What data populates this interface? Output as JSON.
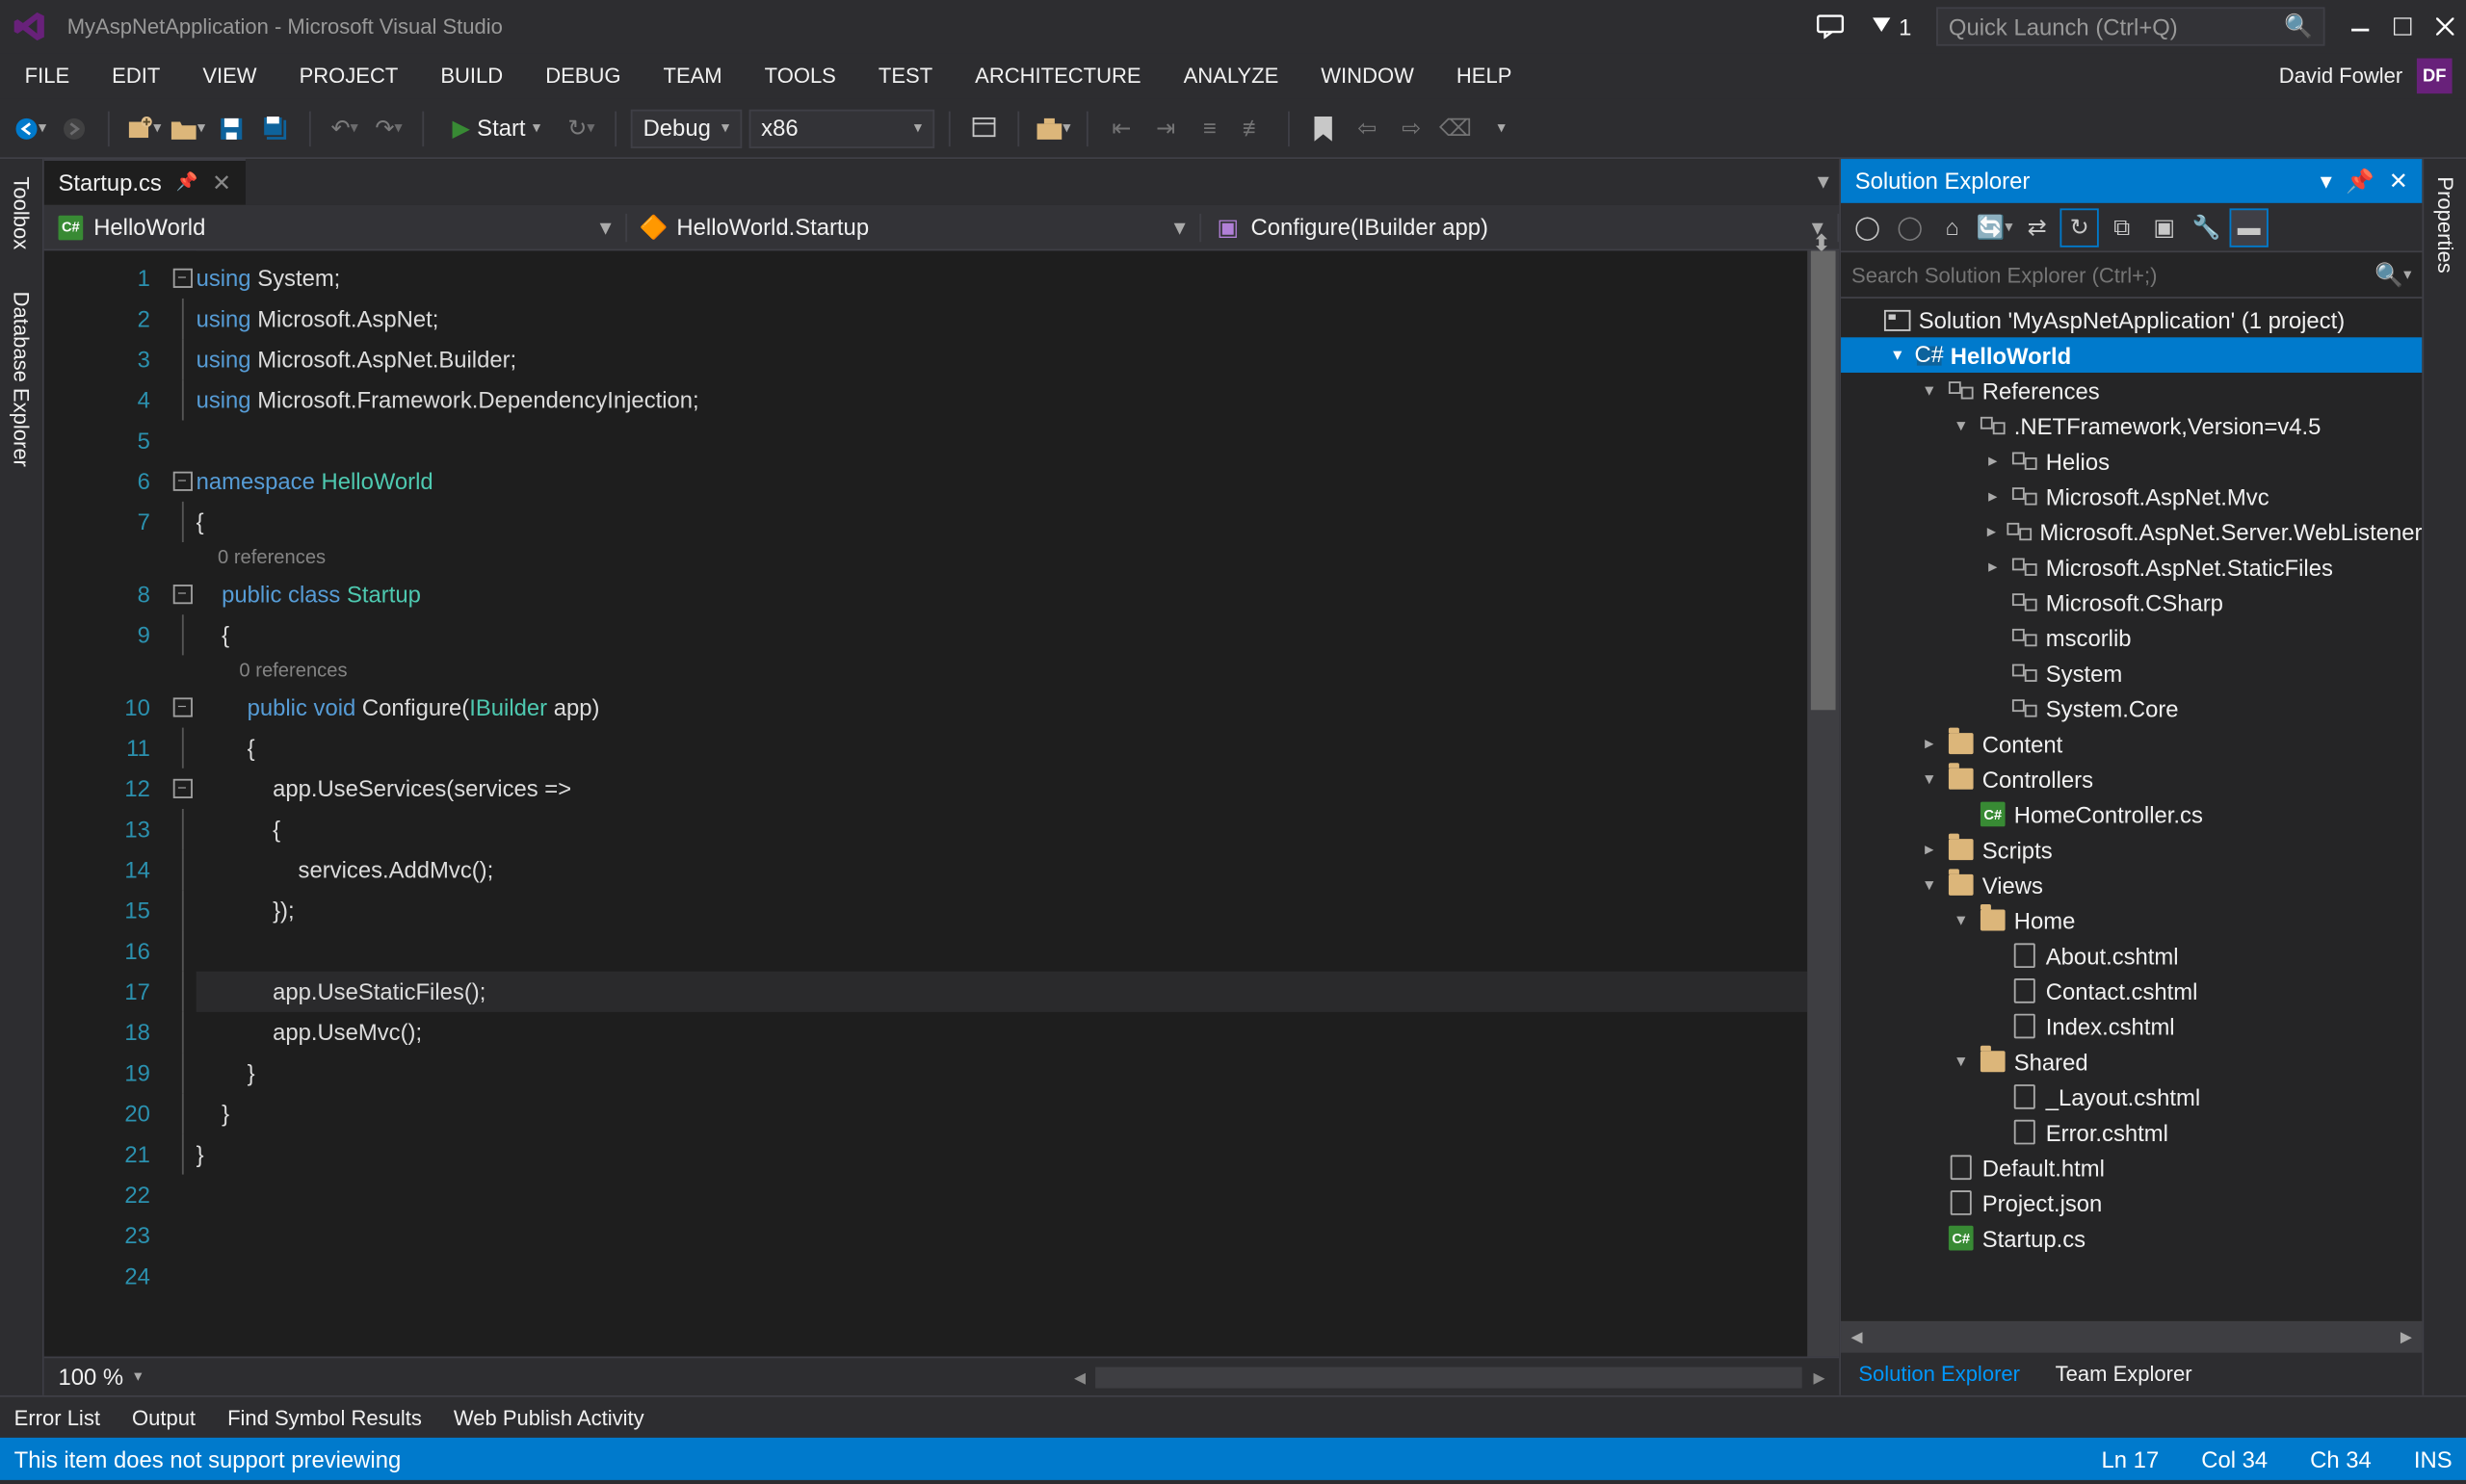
{
  "title": "MyAspNetApplication - Microsoft Visual Studio",
  "notifications_count": "1",
  "quick_launch_placeholder": "Quick Launch (Ctrl+Q)",
  "menu": [
    "FILE",
    "EDIT",
    "VIEW",
    "PROJECT",
    "BUILD",
    "DEBUG",
    "TEAM",
    "TOOLS",
    "TEST",
    "ARCHITECTURE",
    "ANALYZE",
    "WINDOW",
    "HELP"
  ],
  "user": {
    "name": "David Fowler",
    "initials": "DF"
  },
  "toolbar": {
    "start": "Start",
    "config": "Debug",
    "platform": "x86"
  },
  "left_tabs": [
    "Toolbox",
    "Database Explorer"
  ],
  "right_tabs": [
    "Properties"
  ],
  "editor": {
    "tab_name": "Startup.cs",
    "nav1": "HelloWorld",
    "nav2": "HelloWorld.Startup",
    "nav3": "Configure(IBuilder app)",
    "zoom": "100 %",
    "codelens": "0 references",
    "lines": [
      {
        "n": 1,
        "fold": "-",
        "html": "<span class='kw'>using</span> System;"
      },
      {
        "n": 2,
        "fold": "|",
        "html": "<span class='kw'>using</span> Microsoft.AspNet;"
      },
      {
        "n": 3,
        "fold": "|",
        "html": "<span class='kw'>using</span> Microsoft.AspNet.Builder;"
      },
      {
        "n": 4,
        "fold": "|",
        "html": "<span class='kw'>using</span> Microsoft.Framework.DependencyInjection;"
      },
      {
        "n": 5,
        "fold": "",
        "html": ""
      },
      {
        "n": 6,
        "fold": "-",
        "html": "<span class='kw'>namespace</span> <span class='type'>HelloWorld</span>"
      },
      {
        "n": 7,
        "fold": "|",
        "html": "{"
      },
      {
        "n": 0,
        "fold": "",
        "codelens": true,
        "indent": "    "
      },
      {
        "n": 8,
        "fold": "-",
        "html": "    <span class='kw'>public</span> <span class='kw'>class</span> <span class='type'>Startup</span>"
      },
      {
        "n": 9,
        "fold": "|",
        "html": "    {"
      },
      {
        "n": 0,
        "fold": "",
        "codelens": true,
        "indent": "        "
      },
      {
        "n": 10,
        "fold": "-",
        "html": "        <span class='kw'>public</span> <span class='kw'>void</span> Configure(<span class='type'>IBuilder</span> app)"
      },
      {
        "n": 11,
        "fold": "|",
        "html": "        {"
      },
      {
        "n": 12,
        "fold": "-",
        "html": "            app.UseServices(services =&gt;"
      },
      {
        "n": 13,
        "fold": "|",
        "html": "            {"
      },
      {
        "n": 14,
        "fold": "|",
        "html": "                services.AddMvc();"
      },
      {
        "n": 15,
        "fold": "|",
        "html": "            });"
      },
      {
        "n": 16,
        "fold": "|",
        "html": ""
      },
      {
        "n": 17,
        "fold": "|",
        "hl": true,
        "html": "            app.UseStaticFiles();"
      },
      {
        "n": 18,
        "fold": "|",
        "html": "            app.UseMvc();"
      },
      {
        "n": 19,
        "fold": "|",
        "html": "        }"
      },
      {
        "n": 20,
        "fold": "|",
        "html": "    }"
      },
      {
        "n": 21,
        "fold": "|",
        "html": "}"
      },
      {
        "n": 22,
        "fold": "",
        "html": ""
      },
      {
        "n": 23,
        "fold": "",
        "html": ""
      },
      {
        "n": 24,
        "fold": "",
        "html": ""
      }
    ]
  },
  "solution_explorer": {
    "title": "Solution Explorer",
    "search_placeholder": "Search Solution Explorer (Ctrl+;)",
    "tree": [
      {
        "d": 0,
        "exp": "",
        "icon": "sln",
        "label": "Solution 'MyAspNetApplication' (1 project)"
      },
      {
        "d": 1,
        "exp": "▾",
        "icon": "proj",
        "label": "HelloWorld",
        "sel": true,
        "bold": true
      },
      {
        "d": 2,
        "exp": "▾",
        "icon": "ref",
        "label": "References"
      },
      {
        "d": 3,
        "exp": "▾",
        "icon": "ref",
        "label": ".NETFramework,Version=v4.5"
      },
      {
        "d": 4,
        "exp": "▸",
        "icon": "ref",
        "label": "Helios"
      },
      {
        "d": 4,
        "exp": "▸",
        "icon": "ref",
        "label": "Microsoft.AspNet.Mvc"
      },
      {
        "d": 4,
        "exp": "▸",
        "icon": "ref",
        "label": "Microsoft.AspNet.Server.WebListener"
      },
      {
        "d": 4,
        "exp": "▸",
        "icon": "ref",
        "label": "Microsoft.AspNet.StaticFiles"
      },
      {
        "d": 4,
        "exp": "",
        "icon": "ref",
        "label": "Microsoft.CSharp"
      },
      {
        "d": 4,
        "exp": "",
        "icon": "ref",
        "label": "mscorlib"
      },
      {
        "d": 4,
        "exp": "",
        "icon": "ref",
        "label": "System"
      },
      {
        "d": 4,
        "exp": "",
        "icon": "ref",
        "label": "System.Core"
      },
      {
        "d": 2,
        "exp": "▸",
        "icon": "folder",
        "label": "Content"
      },
      {
        "d": 2,
        "exp": "▾",
        "icon": "folder",
        "label": "Controllers"
      },
      {
        "d": 3,
        "exp": "",
        "icon": "cs",
        "label": "HomeController.cs"
      },
      {
        "d": 2,
        "exp": "▸",
        "icon": "folder",
        "label": "Scripts"
      },
      {
        "d": 2,
        "exp": "▾",
        "icon": "folder",
        "label": "Views"
      },
      {
        "d": 3,
        "exp": "▾",
        "icon": "folder",
        "label": "Home"
      },
      {
        "d": 4,
        "exp": "",
        "icon": "file",
        "label": "About.cshtml"
      },
      {
        "d": 4,
        "exp": "",
        "icon": "file",
        "label": "Contact.cshtml"
      },
      {
        "d": 4,
        "exp": "",
        "icon": "file",
        "label": "Index.cshtml"
      },
      {
        "d": 3,
        "exp": "▾",
        "icon": "folder",
        "label": "Shared"
      },
      {
        "d": 4,
        "exp": "",
        "icon": "file",
        "label": "_Layout.cshtml"
      },
      {
        "d": 4,
        "exp": "",
        "icon": "file",
        "label": "Error.cshtml"
      },
      {
        "d": 2,
        "exp": "",
        "icon": "file",
        "label": "Default.html"
      },
      {
        "d": 2,
        "exp": "",
        "icon": "file",
        "label": "Project.json"
      },
      {
        "d": 2,
        "exp": "",
        "icon": "cs",
        "label": "Startup.cs"
      }
    ],
    "panel_tabs": [
      "Solution Explorer",
      "Team Explorer"
    ]
  },
  "bottom_tabs": [
    "Error List",
    "Output",
    "Find Symbol Results",
    "Web Publish Activity"
  ],
  "status": {
    "msg": "This item does not support previewing",
    "ln": "Ln 17",
    "col": "Col 34",
    "ch": "Ch 34",
    "ins": "INS"
  }
}
